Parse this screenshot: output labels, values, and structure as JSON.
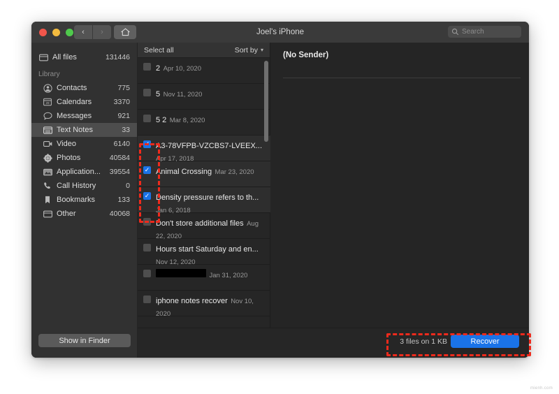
{
  "window": {
    "title": "Joel's iPhone",
    "nav": {
      "back": "‹",
      "forward": "›",
      "home": "home-icon"
    }
  },
  "search": {
    "placeholder": "Search",
    "value": ""
  },
  "sidebar": {
    "all_files": {
      "label": "All files",
      "count": "131446",
      "icon": "folder-icon"
    },
    "section_label": "Library",
    "items": [
      {
        "label": "Contacts",
        "count": "775",
        "icon": "person-icon"
      },
      {
        "label": "Calendars",
        "count": "3370",
        "icon": "calendar-icon"
      },
      {
        "label": "Messages",
        "count": "921",
        "icon": "message-icon"
      },
      {
        "label": "Text Notes",
        "count": "33",
        "icon": "notes-icon",
        "selected": true
      },
      {
        "label": "Video",
        "count": "6140",
        "icon": "video-icon"
      },
      {
        "label": "Photos",
        "count": "40584",
        "icon": "photos-icon"
      },
      {
        "label": "Application...",
        "count": "39554",
        "icon": "application-icon"
      },
      {
        "label": "Call History",
        "count": "0",
        "icon": "phone-icon"
      },
      {
        "label": "Bookmarks",
        "count": "133",
        "icon": "bookmark-icon"
      },
      {
        "label": "Other",
        "count": "40068",
        "icon": "folder-icon"
      }
    ],
    "show_in_finder": "Show in Finder"
  },
  "list": {
    "select_all": "Select all",
    "sort_by": "Sort by",
    "items": [
      {
        "title": "2",
        "date": "Apr 10, 2020",
        "checked": false
      },
      {
        "title": "5",
        "date": "Nov 11, 2020",
        "checked": false
      },
      {
        "title": "5 2",
        "date": "Mar 8, 2020",
        "checked": false
      },
      {
        "title": "A3-78VFPB-VZCBS7-LVEEX...",
        "date": "Apr 17, 2018",
        "checked": true
      },
      {
        "title": "Animal Crossing",
        "date": "Mar 23, 2020",
        "checked": true
      },
      {
        "title": "Density pressure refers to th...",
        "date": "Jan 6, 2018",
        "checked": true
      },
      {
        "title": "Don't store additional files",
        "date": "Aug 22, 2020",
        "checked": false
      },
      {
        "title": "Hours start Saturday and en...",
        "date": "Nov 12, 2020",
        "checked": false
      },
      {
        "title": "",
        "date": "Jan 31, 2020",
        "checked": false,
        "redacted": true
      },
      {
        "title": "iphone notes recover",
        "date": "Nov 10, 2020",
        "checked": false
      }
    ]
  },
  "preview": {
    "sender": "(No Sender)"
  },
  "bottom": {
    "files_info": "3 files on 1 KB",
    "recover_label": "Recover"
  },
  "watermark": "mienh.com",
  "colors": {
    "accent_blue": "#1a73e8",
    "annotation_red": "#ee2a1c",
    "window_bg": "#2b2b2b",
    "sidebar_bg": "#313131"
  }
}
